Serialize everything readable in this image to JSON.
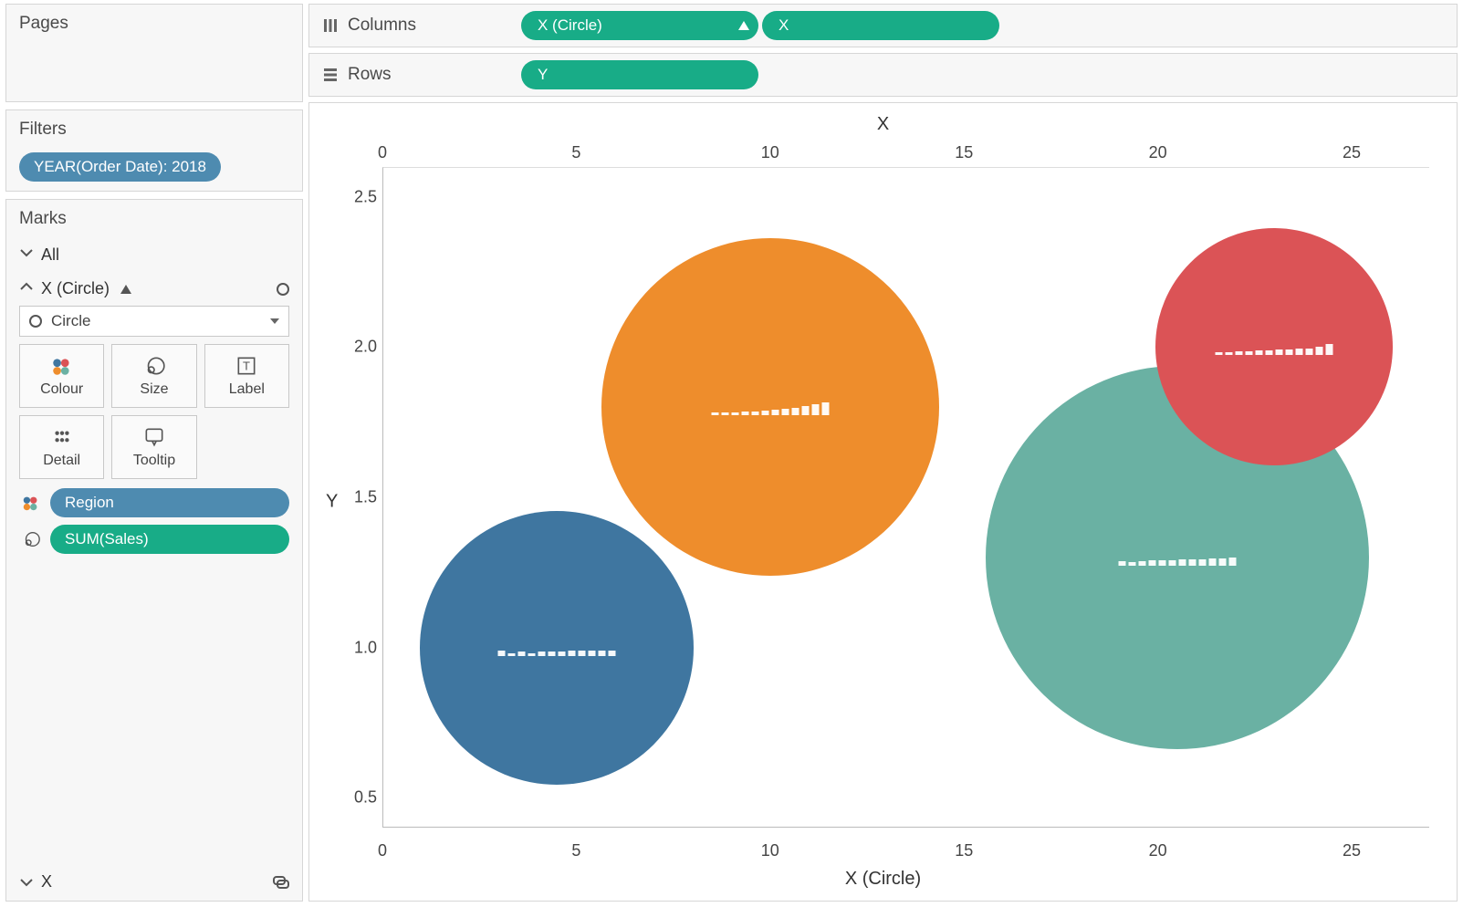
{
  "left": {
    "pages_title": "Pages",
    "filters_title": "Filters",
    "filter_pill": "YEAR(Order Date): 2018",
    "marks_title": "Marks",
    "marks_all": "All",
    "marks_layer": "X (Circle)",
    "mark_type": "Circle",
    "mark_buttons": {
      "colour": "Colour",
      "size": "Size",
      "label": "Label",
      "detail": "Detail",
      "tooltip": "Tooltip"
    },
    "mark_pills": {
      "region": "Region",
      "sum_sales": "SUM(Sales)"
    },
    "marks_footer_x": "X"
  },
  "shelves": {
    "columns_label": "Columns",
    "rows_label": "Rows",
    "col_pill_1": "X (Circle)",
    "col_pill_2": "X",
    "row_pill_1": "Y"
  },
  "chart_data": {
    "type": "scatter",
    "x_title_top": "X",
    "x_title_bottom": "X (Circle)",
    "y_title": "Y",
    "x_ticks": [
      0,
      5,
      10,
      15,
      20,
      25
    ],
    "y_ticks": [
      0.5,
      1.0,
      1.5,
      2.0,
      2.5
    ],
    "xlim": [
      0,
      27
    ],
    "ylim": [
      0.4,
      2.6
    ],
    "series": [
      {
        "name": "Blue",
        "x": 4.5,
        "y": 1.0,
        "radius": 150,
        "color": "#3f76a0"
      },
      {
        "name": "Orange",
        "x": 10.0,
        "y": 1.8,
        "radius": 185,
        "color": "#ee8d2c"
      },
      {
        "name": "Green",
        "x": 20.5,
        "y": 1.3,
        "radius": 210,
        "color": "#6ab1a3"
      },
      {
        "name": "Red",
        "x": 23.0,
        "y": 2.0,
        "radius": 130,
        "color": "#db5356"
      }
    ],
    "spark_bars": {
      "Blue": [
        6,
        3,
        5,
        3,
        5,
        5,
        5,
        6,
        6,
        6,
        6,
        6
      ],
      "Orange": [
        3,
        3,
        3,
        4,
        4,
        5,
        6,
        7,
        8,
        10,
        12,
        14
      ],
      "Green": [
        5,
        4,
        5,
        6,
        6,
        6,
        7,
        7,
        7,
        8,
        8,
        9
      ],
      "Red": [
        3,
        3,
        4,
        4,
        5,
        5,
        6,
        6,
        7,
        7,
        9,
        12
      ]
    }
  }
}
